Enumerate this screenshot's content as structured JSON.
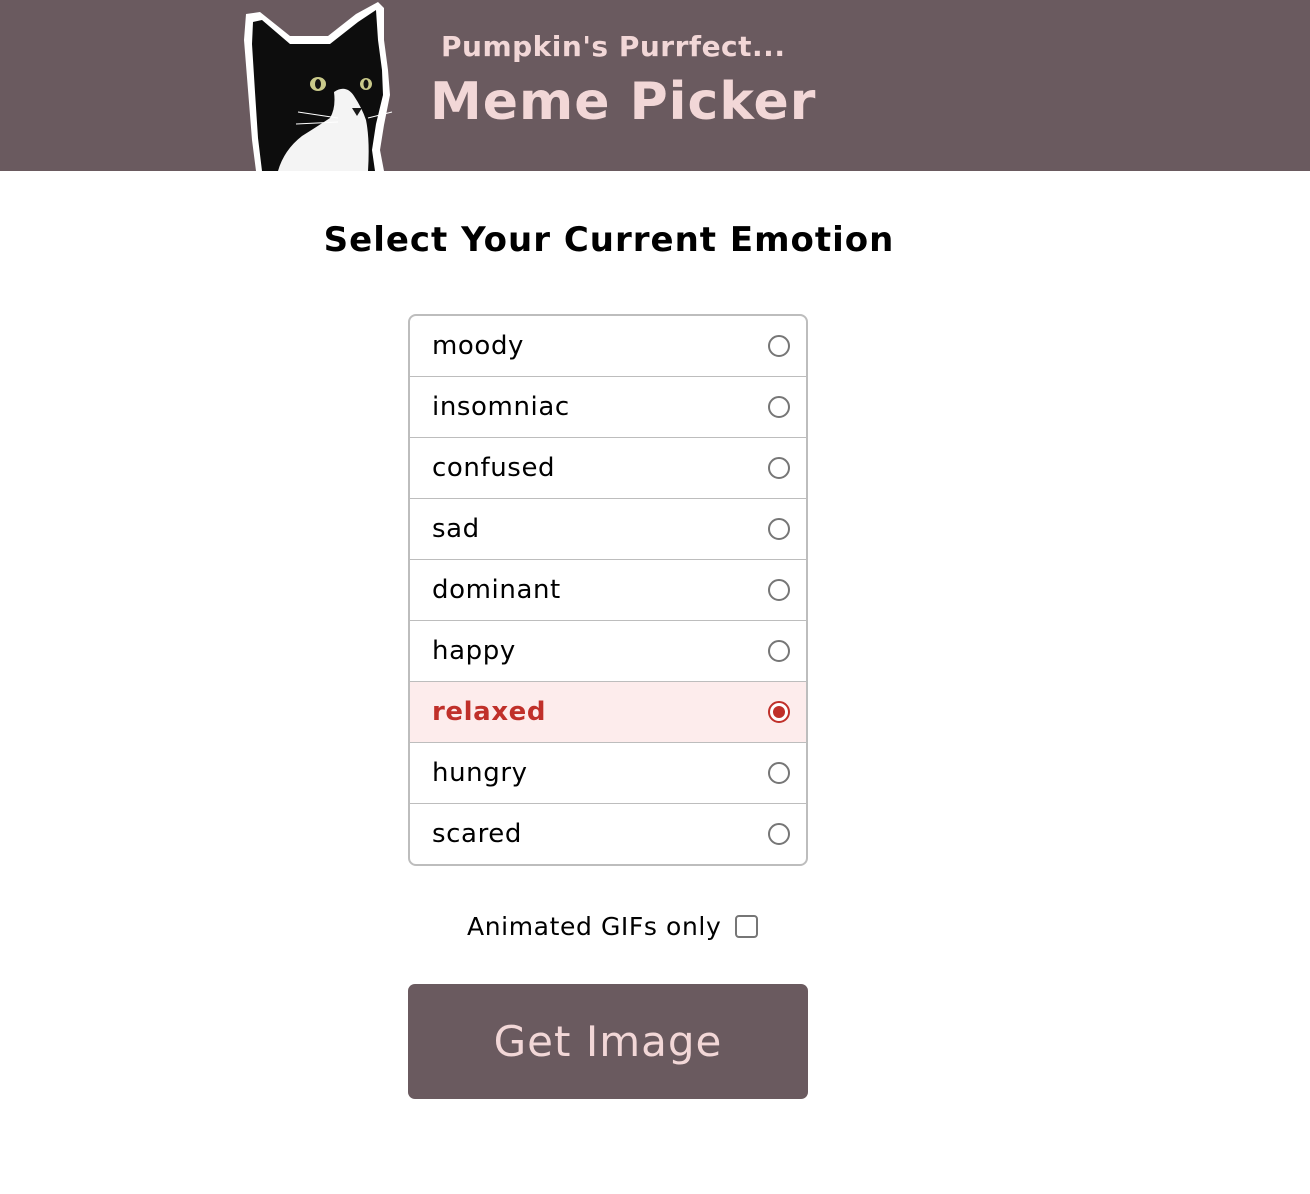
{
  "header": {
    "subtitle": "Pumpkin's Purrfect...",
    "title": "Meme Picker",
    "background_color": "#6a5a5f",
    "text_color": "#f2d7d7"
  },
  "heading": "Select Your Current Emotion",
  "emotions": [
    {
      "label": "moody",
      "selected": false
    },
    {
      "label": "insomniac",
      "selected": false
    },
    {
      "label": "confused",
      "selected": false
    },
    {
      "label": "sad",
      "selected": false
    },
    {
      "label": "dominant",
      "selected": false
    },
    {
      "label": "happy",
      "selected": false
    },
    {
      "label": "relaxed",
      "selected": true
    },
    {
      "label": "hungry",
      "selected": false
    },
    {
      "label": "scared",
      "selected": false
    }
  ],
  "selected_color": "#c0302a",
  "selected_bg": "#fdecec",
  "gifs_only": {
    "label": "Animated GIFs only",
    "checked": false
  },
  "button": {
    "label": "Get Image"
  }
}
